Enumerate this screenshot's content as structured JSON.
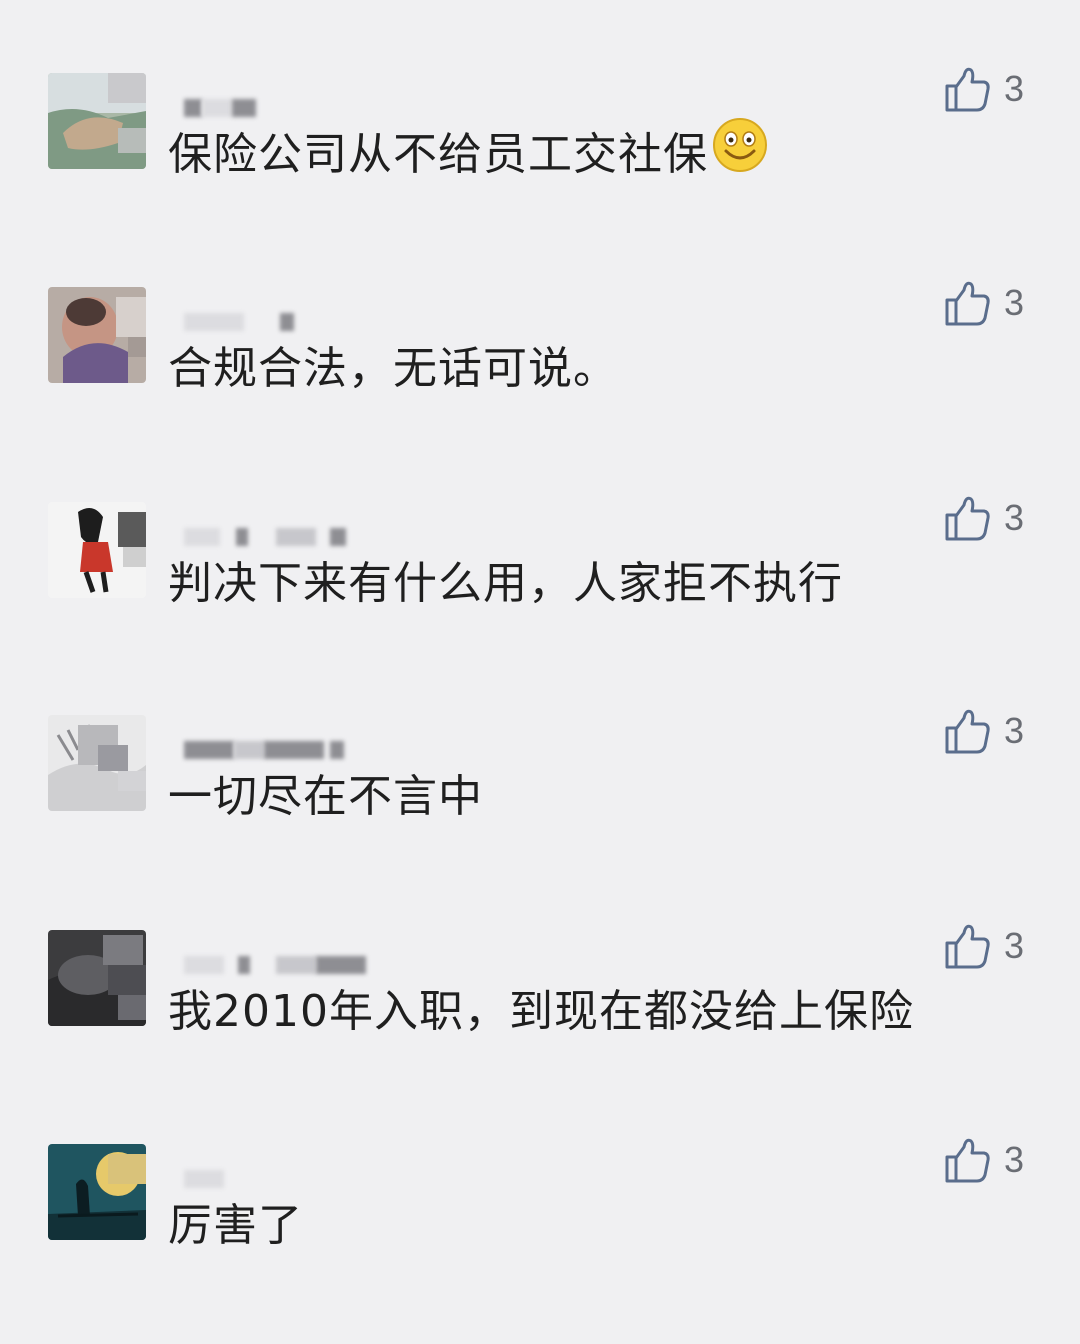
{
  "comments": [
    {
      "text": "保险公司从不给员工交社保",
      "likes": "3",
      "emoji": "smile-emoji"
    },
    {
      "text": "合规合法，无话可说。",
      "likes": "3"
    },
    {
      "text": "判决下来有什么用，人家拒不执行",
      "likes": "3"
    },
    {
      "text": "一切尽在不言中",
      "likes": "3"
    },
    {
      "text": "我2010年入职，到现在都没给上保险",
      "likes": "3"
    },
    {
      "text": "厉害了",
      "likes": "3"
    }
  ],
  "icons": {
    "like": "thumbs-up-icon"
  },
  "colors": {
    "background": "#f0f0f2",
    "text": "#1f1f1f",
    "icon": "#5a6d8c",
    "count": "#6a6d74"
  }
}
